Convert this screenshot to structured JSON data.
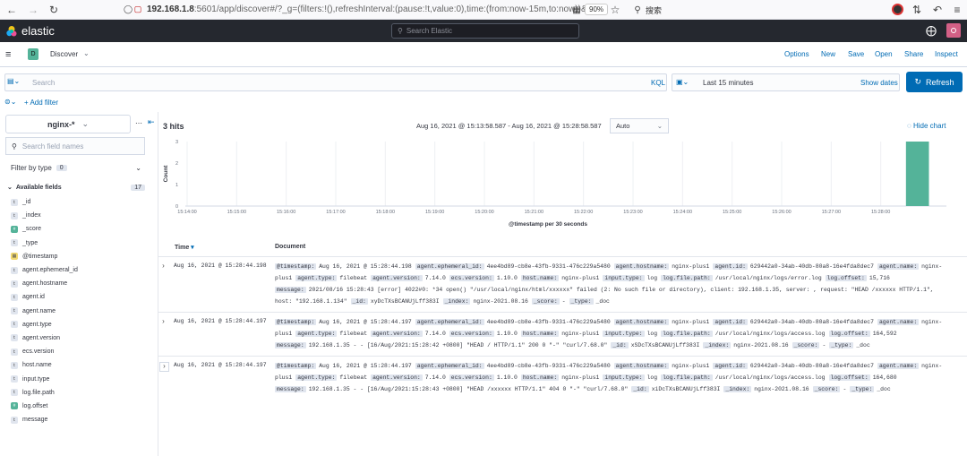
{
  "browser": {
    "url_host": "192.168.1.8",
    "url_rest": ":5601/app/discover#/?_g=(filters:!(),refreshInterval:(pause:!t,value:0),time:(from:now-15m,to:now))&_a=(c",
    "zoom": "90%",
    "search_placeholder": "搜索"
  },
  "header": {
    "brand": "elastic",
    "search_placeholder": "Search Elastic"
  },
  "appbar": {
    "space_letter": "D",
    "app_name": "Discover",
    "menu": [
      "Options",
      "New",
      "Save",
      "Open",
      "Share",
      "Inspect"
    ]
  },
  "querybar": {
    "placeholder": "Search",
    "language": "KQL",
    "time_range": "Last 15 minutes",
    "show_dates": "Show dates",
    "refresh": "Refresh"
  },
  "filter": {
    "add_filter": "+ Add filter"
  },
  "sidebar": {
    "index_pattern": "nginx-*",
    "search_placeholder": "Search field names",
    "filter_by_type": "Filter by type",
    "filter_count": "0",
    "available_fields_label": "Available fields",
    "available_count": "17",
    "fields": [
      {
        "type": "t",
        "name": "_id"
      },
      {
        "type": "t",
        "name": "_index"
      },
      {
        "type": "#",
        "name": "_score"
      },
      {
        "type": "t",
        "name": "_type"
      },
      {
        "type": "cal",
        "name": "@timestamp"
      },
      {
        "type": "t",
        "name": "agent.ephemeral_id"
      },
      {
        "type": "t",
        "name": "agent.hostname"
      },
      {
        "type": "t",
        "name": "agent.id"
      },
      {
        "type": "t",
        "name": "agent.name"
      },
      {
        "type": "t",
        "name": "agent.type"
      },
      {
        "type": "t",
        "name": "agent.version"
      },
      {
        "type": "t",
        "name": "ecs.version"
      },
      {
        "type": "t",
        "name": "host.name"
      },
      {
        "type": "t",
        "name": "input.type"
      },
      {
        "type": "t",
        "name": "log.file.path"
      },
      {
        "type": "#",
        "name": "log.offset"
      },
      {
        "type": "t",
        "name": "message"
      }
    ]
  },
  "main": {
    "hits": "3 hits",
    "date_range": "Aug 16, 2021 @ 15:13:58.587 - Aug 16, 2021 @ 15:28:58.587",
    "interval": "Auto",
    "hide_chart": "Hide chart",
    "col_time": "Time",
    "col_document": "Document"
  },
  "chart_data": {
    "type": "bar",
    "x": [
      "15:14:00",
      "15:15:00",
      "15:16:00",
      "15:17:00",
      "15:18:00",
      "15:19:00",
      "15:20:00",
      "15:21:00",
      "15:22:00",
      "15:23:00",
      "15:24:00",
      "15:25:00",
      "15:26:00",
      "15:27:00",
      "15:28:00"
    ],
    "bar": {
      "x": "15:28:30",
      "value": 3
    },
    "xlabel": "@timestamp per 30 seconds",
    "ylabel": "Count",
    "yticks": [
      "0",
      "1",
      "2",
      "3"
    ],
    "ylim": [
      0,
      3
    ],
    "color": "#54b399"
  },
  "rows": [
    {
      "time": "Aug 16, 2021 @ 15:28:44.198",
      "lines": [
        [
          [
            "@timestamp:",
            "Aug 16, 2021 @ 15:28:44.198"
          ],
          [
            "agent.ephemeral_id:",
            "4ee4bd89-cb8e-43fb-9331-476c229a5480"
          ],
          [
            "agent.hostname:",
            "nginx-plus1"
          ],
          [
            "agent.id:",
            "629442a0-34ab-40db-80a8-16e4fda8dec7"
          ],
          [
            "agent.name:",
            "nginx-"
          ]
        ],
        [
          [
            "",
            "plus1"
          ],
          [
            "agent.type:",
            "filebeat"
          ],
          [
            "agent.version:",
            "7.14.0"
          ],
          [
            "ecs.version:",
            "1.10.0"
          ],
          [
            "host.name:",
            "nginx-plus1"
          ],
          [
            "input.type:",
            "log"
          ],
          [
            "log.file.path:",
            "/usr/local/nginx/logs/error.log"
          ],
          [
            "log.offset:",
            "15,716"
          ]
        ],
        [
          [
            "message:",
            "2021/08/16 15:28:43 [error] 4022#0: *34 open() \"/usr/local/nginx/html/xxxxxx\" failed (2: No such file or directory), client: 192.168.1.35, server: , request: \"HEAD /xxxxxx HTTP/1.1\","
          ]
        ],
        [
          [
            "",
            "host: \"192.168.1.134\""
          ],
          [
            "_id:",
            "xyDcTXsBCANUjLff383I"
          ],
          [
            "_index:",
            "nginx-2021.08.16"
          ],
          [
            "_score:",
            "-"
          ],
          [
            "_type:",
            "_doc"
          ]
        ]
      ]
    },
    {
      "time": "Aug 16, 2021 @ 15:28:44.197",
      "lines": [
        [
          [
            "@timestamp:",
            "Aug 16, 2021 @ 15:28:44.197"
          ],
          [
            "agent.ephemeral_id:",
            "4ee4bd89-cb8e-43fb-9331-476c229a5480"
          ],
          [
            "agent.hostname:",
            "nginx-plus1"
          ],
          [
            "agent.id:",
            "629442a0-34ab-40db-80a8-16e4fda8dec7"
          ],
          [
            "agent.name:",
            "nginx-"
          ]
        ],
        [
          [
            "",
            "plus1"
          ],
          [
            "agent.type:",
            "filebeat"
          ],
          [
            "agent.version:",
            "7.14.0"
          ],
          [
            "ecs.version:",
            "1.10.0"
          ],
          [
            "host.name:",
            "nginx-plus1"
          ],
          [
            "input.type:",
            "log"
          ],
          [
            "log.file.path:",
            "/usr/local/nginx/logs/access.log"
          ],
          [
            "log.offset:",
            "164,592"
          ]
        ],
        [
          [
            "message:",
            "192.168.1.35 - - [16/Aug/2021:15:28:42 +0800] \"HEAD / HTTP/1.1\" 200 0 \"-\" \"curl/7.68.0\""
          ],
          [
            "_id:",
            "xSDcTXsBCANUjLff383I"
          ],
          [
            "_index:",
            "nginx-2021.08.16"
          ],
          [
            "_score:",
            "-"
          ],
          [
            "_type:",
            "_doc"
          ]
        ]
      ]
    },
    {
      "time": "Aug 16, 2021 @ 15:28:44.197",
      "lines": [
        [
          [
            "@timestamp:",
            "Aug 16, 2021 @ 15:28:44.197"
          ],
          [
            "agent.ephemeral_id:",
            "4ee4bd89-cb8e-43fb-9331-476c229a5480"
          ],
          [
            "agent.hostname:",
            "nginx-plus1"
          ],
          [
            "agent.id:",
            "629442a0-34ab-40db-80a8-16e4fda8dec7"
          ],
          [
            "agent.name:",
            "nginx-"
          ]
        ],
        [
          [
            "",
            "plus1"
          ],
          [
            "agent.type:",
            "filebeat"
          ],
          [
            "agent.version:",
            "7.14.0"
          ],
          [
            "ecs.version:",
            "1.10.0"
          ],
          [
            "host.name:",
            "nginx-plus1"
          ],
          [
            "input.type:",
            "log"
          ],
          [
            "log.file.path:",
            "/usr/local/nginx/logs/access.log"
          ],
          [
            "log.offset:",
            "164,680"
          ]
        ],
        [
          [
            "message:",
            "192.168.1.35 - - [16/Aug/2021:15:28:43 +0800] \"HEAD /xxxxxx HTTP/1.1\" 404 0 \"-\" \"curl/7.68.0\""
          ],
          [
            "_id:",
            "xiDcTXsBCANUjLff383I"
          ],
          [
            "_index:",
            "nginx-2021.08.16"
          ],
          [
            "_score:",
            "-"
          ],
          [
            "_type:",
            "_doc"
          ]
        ]
      ]
    }
  ]
}
